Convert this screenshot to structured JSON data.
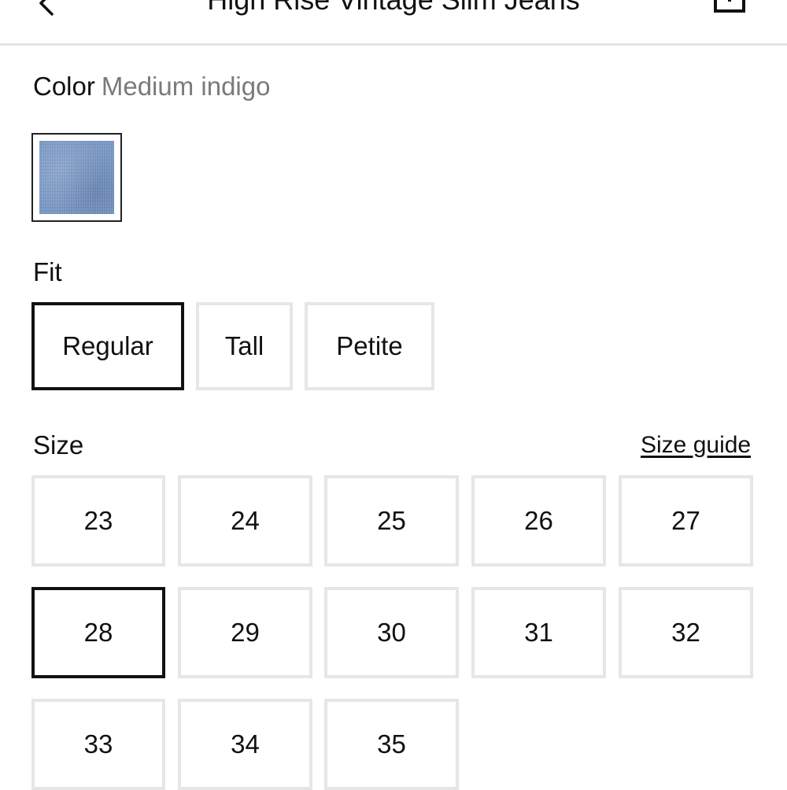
{
  "header": {
    "title": "High Rise Vintage Slim Jeans",
    "back_icon": "chevron-left-icon",
    "share_icon": "share-icon"
  },
  "color": {
    "label": "Color",
    "value": "Medium indigo",
    "swatches": [
      {
        "name": "Medium indigo",
        "selected": true,
        "color": "#7a98c4"
      }
    ]
  },
  "fit": {
    "label": "Fit",
    "options": [
      {
        "label": "Regular",
        "selected": true
      },
      {
        "label": "Tall",
        "selected": false
      },
      {
        "label": "Petite",
        "selected": false
      }
    ]
  },
  "size": {
    "label": "Size",
    "guide_link": "Size guide",
    "options": [
      {
        "label": "23",
        "selected": false
      },
      {
        "label": "24",
        "selected": false
      },
      {
        "label": "25",
        "selected": false
      },
      {
        "label": "26",
        "selected": false
      },
      {
        "label": "27",
        "selected": false
      },
      {
        "label": "28",
        "selected": true
      },
      {
        "label": "29",
        "selected": false
      },
      {
        "label": "30",
        "selected": false
      },
      {
        "label": "31",
        "selected": false
      },
      {
        "label": "32",
        "selected": false
      },
      {
        "label": "33",
        "selected": false
      },
      {
        "label": "34",
        "selected": false
      },
      {
        "label": "35",
        "selected": false
      }
    ]
  },
  "colors": {
    "selected_border": "#111111",
    "unselected_border": "#e6e6e6",
    "muted_text": "#7a7a7a"
  }
}
